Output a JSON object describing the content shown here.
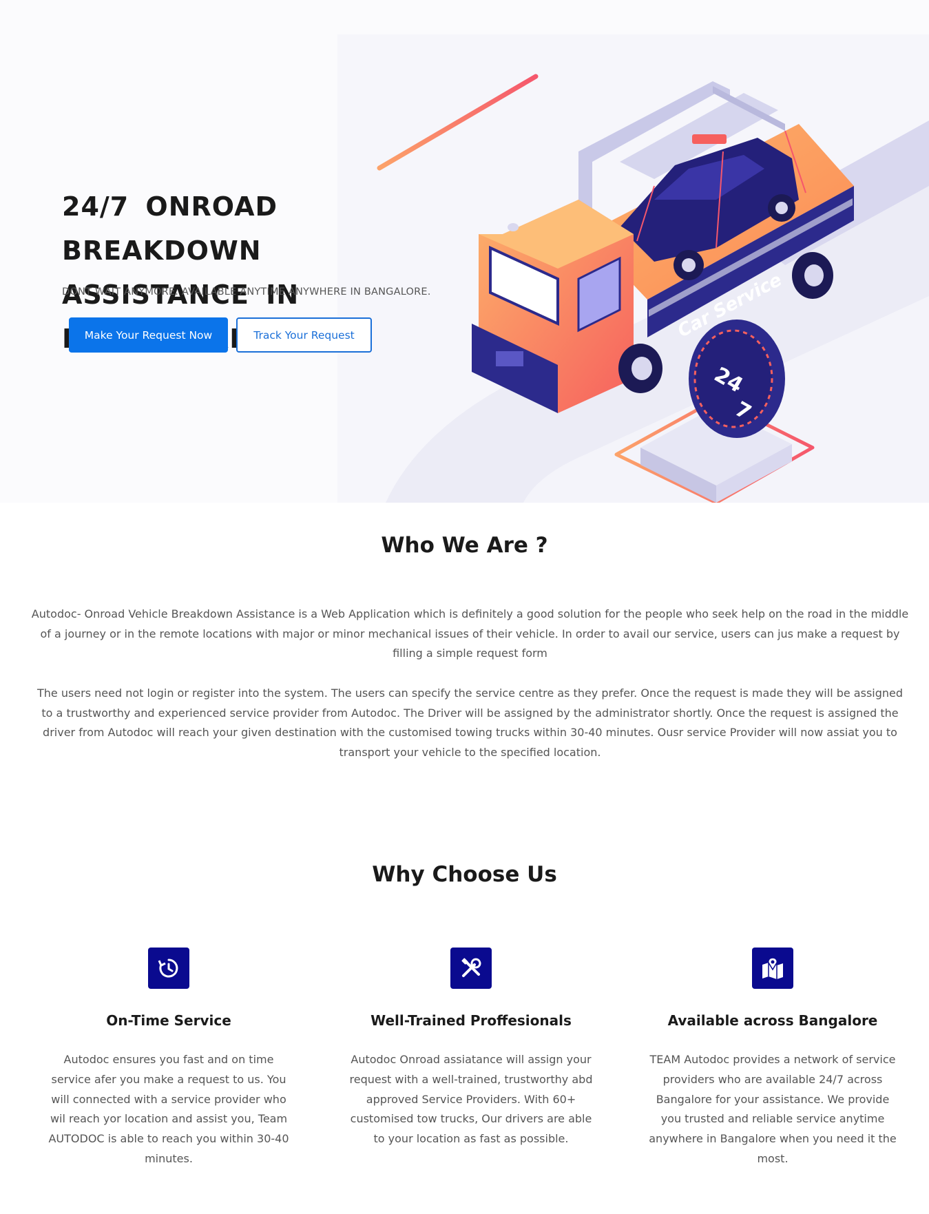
{
  "hero": {
    "title_line1": "24/7 ONROAD BREAKDOWN",
    "title_line2": "ASSISTANCE IN BANGALORE",
    "subtitle": "DONT WAIT ANYMORE. AVAILABLE ANYTIME ANYWHERE IN BANGALORE.",
    "primary_button": "Make Your Request Now",
    "secondary_button": "Track Your Request",
    "truck_label": "Car Service",
    "badge_text_top": "24",
    "badge_text_bottom": "7"
  },
  "who": {
    "title": "Who We Are ?",
    "paragraph1": "Autodoc- Onroad Vehicle Breakdown Assistance is a Web Application which is definitely a good solution for the people who seek help on the road in the middle of a journey or in the remote locations with major or minor mechanical issues of their vehicle. In order to avail our service, users can jus make a request by filling a simple request form",
    "paragraph2": "The users need not login or register into the system. The users can specify the service centre as they prefer. Once the request is made they will be assigned to a trustworthy and experienced service provider from Autodoc. The Driver will be assigned by the administrator shortly. Once the request is assigned the driver from Autodoc will reach your given destination with the customised towing trucks within 30-40 minutes. Ousr service Provider will now assiat you to transport your vehicle to the specified location."
  },
  "why": {
    "title": "Why Choose Us",
    "features": [
      {
        "icon": "clock-history-icon",
        "title": "On-Time Service",
        "text": "Autodoc ensures you fast and on time service afer you make a request to us. You will connected with a service provider who wil reach yor location and assist you, Team AUTODOC is able to reach you within 30-40 minutes."
      },
      {
        "icon": "tools-icon",
        "title": "Well-Trained Proffesionals",
        "text": "Autodoc Onroad assiatance will assign your request with a well-trained, trustworthy abd approved Service Providers. With 60+ customised tow trucks, Our drivers are able to your location as fast as possible."
      },
      {
        "icon": "map-location-icon",
        "title": "Available across Bangalore",
        "text": "TEAM Autodoc provides a network of service providers who are available 24/7 across Bangalore for your assistance. We provide you trusted and reliable service anytime anywhere in Bangalore when you need it the most."
      }
    ]
  },
  "colors": {
    "primary": "#0b74ea",
    "icon_bg": "#0a0a8f",
    "truck_orange": "#fb8a55",
    "truck_navy": "#2c2a8c"
  }
}
